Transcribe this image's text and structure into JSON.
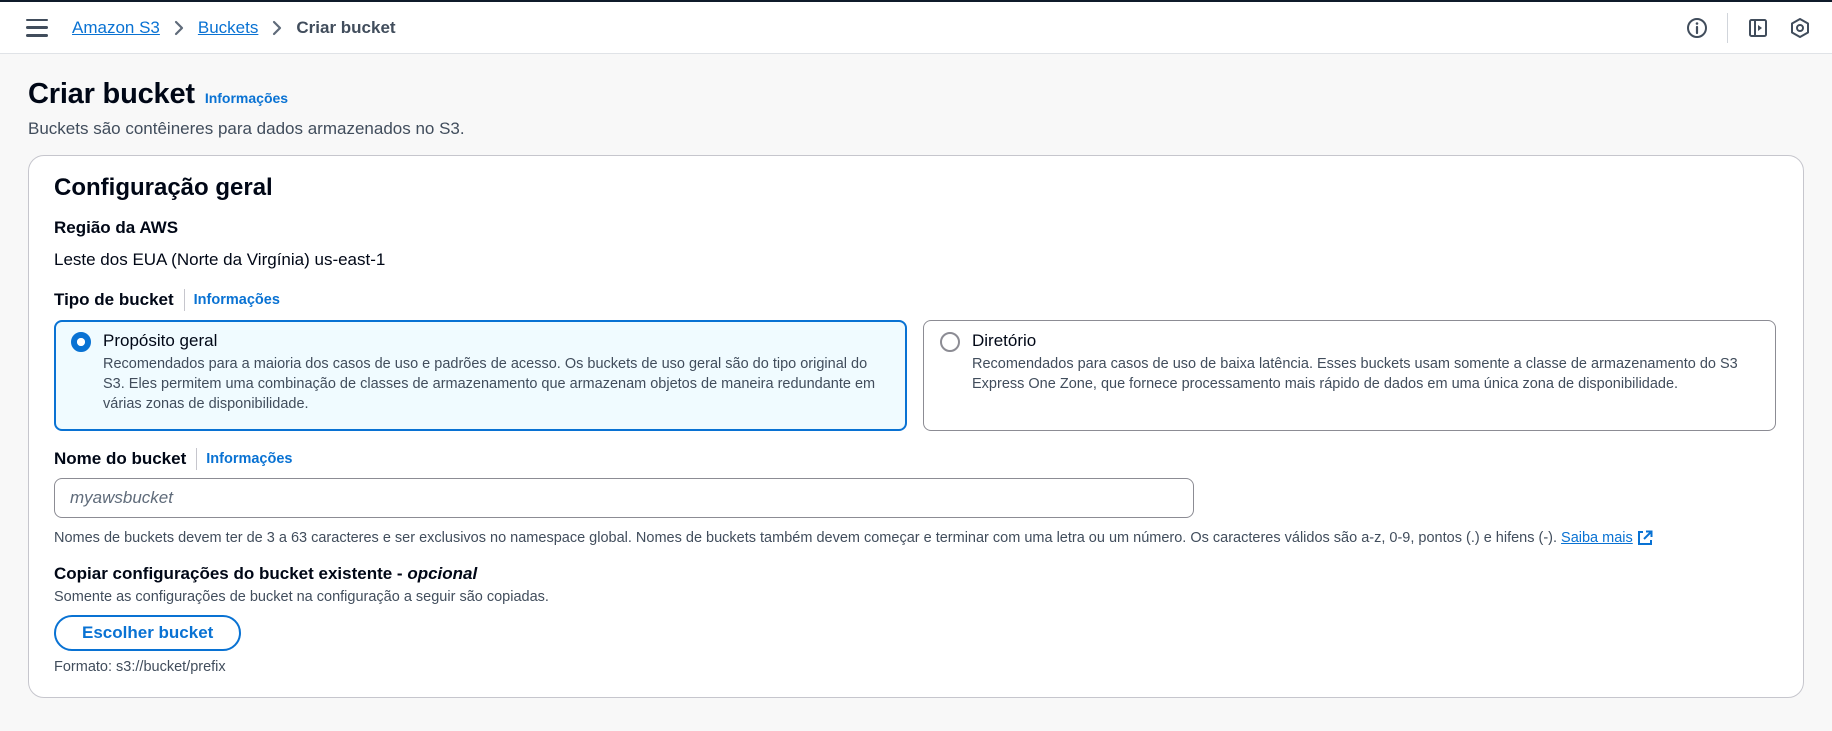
{
  "breadcrumb": {
    "items": [
      "Amazon S3",
      "Buckets"
    ],
    "current": "Criar bucket"
  },
  "icons": {
    "menu": "hamburger-menu-icon",
    "info": "info-circle-icon",
    "panel": "side-panel-icon",
    "notifications": "hexagon-badge-icon",
    "external": "external-link-icon"
  },
  "page": {
    "title": "Criar bucket",
    "info_link": "Informações",
    "description": "Buckets são contêineres para dados armazenados no S3."
  },
  "general_config": {
    "title": "Configuração geral",
    "region": {
      "label": "Região da AWS",
      "value": "Leste dos EUA (Norte da Virgínia) us-east-1"
    },
    "bucket_type": {
      "label": "Tipo de bucket",
      "info": "Informações",
      "options": [
        {
          "title": "Propósito geral",
          "description": "Recomendados para a maioria dos casos de uso e padrões de acesso. Os buckets de uso geral são do tipo original do S3. Eles permitem uma combinação de classes de armazenamento que armazenam objetos de maneira redundante em várias zonas de disponibilidade.",
          "selected": true
        },
        {
          "title": "Diretório",
          "description": "Recomendados para casos de uso de baixa latência. Esses buckets usam somente a classe de armazenamento do S3 Express One Zone, que fornece processamento mais rápido de dados em uma única zona de disponibilidade.",
          "selected": false
        }
      ]
    },
    "bucket_name": {
      "label": "Nome do bucket",
      "info": "Informações",
      "value": "",
      "placeholder": "myawsbucket",
      "hint": "Nomes de buckets devem ter de 3 a 63 caracteres e ser exclusivos no namespace global. Nomes de buckets também devem começar e terminar com uma letra ou um número. Os caracteres válidos são a-z, 0-9, pontos (.) e hifens (-).",
      "learn_more": "Saiba mais"
    },
    "copy_settings": {
      "label": "Copiar configurações do bucket existente - ",
      "optional": "opcional",
      "description": "Somente as configurações de bucket na configuração a seguir são copiadas.",
      "button": "Escolher bucket",
      "format": "Formato: s3://bucket/prefix"
    }
  },
  "colors": {
    "accent": "#0972d3",
    "selected_tile_bg": "#f0fbff",
    "text": "#000716",
    "muted": "#414d5c"
  }
}
